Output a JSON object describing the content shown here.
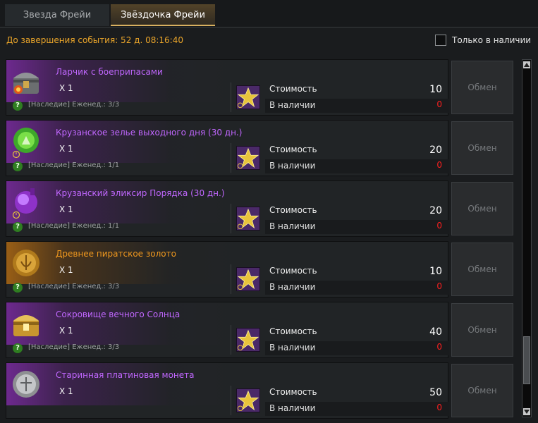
{
  "tabs": [
    {
      "label": "Звезда Фрейи",
      "active": false
    },
    {
      "label": "Звёздочка Фрейи",
      "active": true
    }
  ],
  "timer_text": "До завершения события: 52 д. 08:16:40",
  "filter": {
    "label": "Только в наличии",
    "checked": false
  },
  "cost_label": "Стоимость",
  "stock_label": "В наличии",
  "exchange_label": "Обмен",
  "info_glyph": "?",
  "items": [
    {
      "name": "Ларчик с боеприпасами",
      "rarity": "purple",
      "qty": "X 1",
      "limit": "[Наследие] Еженед.: 3/3",
      "cost": "10",
      "stock": "0",
      "icon": "treasure-chest-icon"
    },
    {
      "name": "Крузанское зелье выходного дня (30 дн.)",
      "rarity": "purple",
      "qty": "X 1",
      "limit": "[Наследие] Еженед.: 1/1",
      "cost": "20",
      "stock": "0",
      "icon": "green-potion-icon"
    },
    {
      "name": "Крузанский эликсир Порядка (30 дн.)",
      "rarity": "purple",
      "qty": "X 1",
      "limit": "[Наследие] Еженед.: 1/1",
      "cost": "20",
      "stock": "0",
      "icon": "purple-elixir-icon"
    },
    {
      "name": "Древнее пиратское золото",
      "rarity": "orange",
      "qty": "X 1",
      "limit": "[Наследие] Еженед.: 3/3",
      "cost": "10",
      "stock": "0",
      "icon": "gold-coin-icon"
    },
    {
      "name": "Сокровище вечного Солнца",
      "rarity": "purple",
      "qty": "X 1",
      "limit": "[Наследие] Еженед.: 3/3",
      "cost": "40",
      "stock": "0",
      "icon": "golden-chest-icon"
    },
    {
      "name": "Старинная платиновая монета",
      "rarity": "purple",
      "qty": "X 1",
      "limit": "",
      "cost": "50",
      "stock": "0",
      "icon": "platinum-coin-icon"
    }
  ],
  "colors": {
    "purple": "#c167ff",
    "orange": "#f0981e",
    "stock_zero": "#ff1f1f",
    "timer": "#eaa52a"
  }
}
